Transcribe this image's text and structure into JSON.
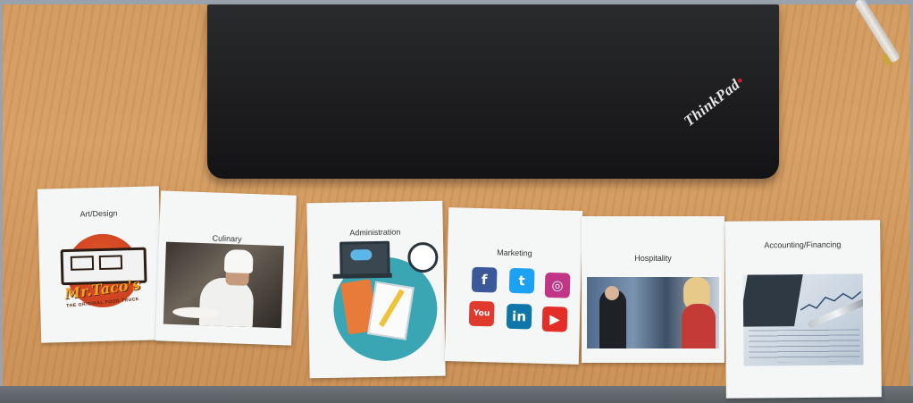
{
  "cards": {
    "art_design": {
      "title": "Art/Design",
      "logo_name": "Mr.Taco's",
      "logo_tagline": "THE ORIGINAL FOOD TRUCK"
    },
    "culinary": {
      "title": "Culinary"
    },
    "administration": {
      "title": "Administration"
    },
    "marketing": {
      "title": "Marketing",
      "icons": [
        {
          "name": "facebook-icon",
          "glyph": "f",
          "color": "#3b5998"
        },
        {
          "name": "twitter-icon",
          "glyph": "t",
          "color": "#1da1f2"
        },
        {
          "name": "instagram-icon",
          "glyph": "◎",
          "color": "#c13584"
        },
        {
          "name": "youtube-icon",
          "glyph": "You",
          "color": "#e03a2f"
        },
        {
          "name": "linkedin-icon",
          "glyph": "in",
          "color": "#0e76a8"
        },
        {
          "name": "youtube-play-icon",
          "glyph": "▶",
          "color": "#e52d27"
        }
      ]
    },
    "hospitality": {
      "title": "Hospitality"
    },
    "accounting": {
      "title": "Accounting/Financing"
    }
  },
  "laptop": {
    "brand": "ThinkPad"
  },
  "colors": {
    "desk": "#d29a5e",
    "laptop": "#1c1c1e",
    "card": "#f5f6f6"
  }
}
